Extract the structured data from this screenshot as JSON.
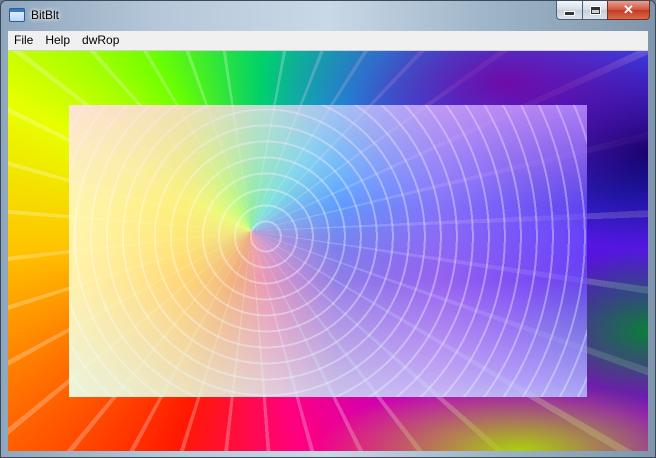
{
  "window": {
    "title": "BitBlt",
    "controls": {
      "minimize": "minimize",
      "maximize": "maximize",
      "close": "✕"
    }
  },
  "menu": {
    "items": [
      "File",
      "Help",
      "dwRop"
    ]
  },
  "icons": {
    "app": "window-app-icon",
    "minimize": "minimize-icon",
    "maximize": "maximize-icon",
    "close": "close-icon"
  }
}
